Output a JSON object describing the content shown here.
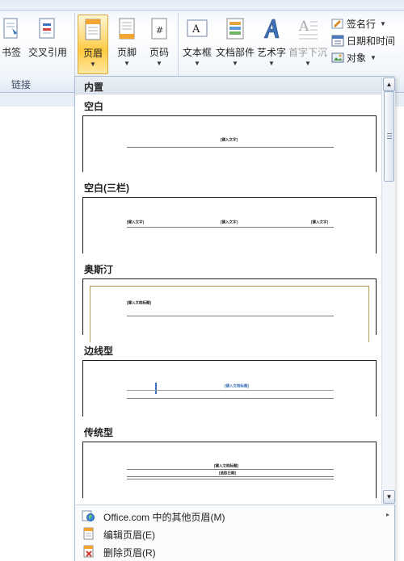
{
  "ribbon": {
    "buttons": [
      {
        "label": "书签",
        "icon": "bookmark-icon"
      },
      {
        "label": "交叉引用",
        "icon": "cross-reference-icon"
      },
      {
        "label": "页眉",
        "icon": "header-icon"
      },
      {
        "label": "页脚",
        "icon": "footer-icon"
      },
      {
        "label": "页码",
        "icon": "page-number-icon"
      },
      {
        "label": "文本框",
        "icon": "textbox-icon"
      },
      {
        "label": "文档部件",
        "icon": "quick-parts-icon"
      },
      {
        "label": "艺术字",
        "icon": "wordart-icon"
      },
      {
        "label": "首字下沉",
        "icon": "drop-cap-icon"
      }
    ],
    "small_buttons": [
      {
        "label": "签名行",
        "icon": "signature-line-icon"
      },
      {
        "label": "日期和时间",
        "icon": "date-time-icon"
      },
      {
        "label": "对象",
        "icon": "object-icon"
      }
    ],
    "group_label": "链接",
    "accent": "#ffc93f"
  },
  "gallery": {
    "header": "内置",
    "sections": [
      {
        "title": "空白",
        "placeholders": [
          "[键入文字]"
        ]
      },
      {
        "title": "空白(三栏)",
        "placeholders": [
          "[键入文字]",
          "[键入文字]",
          "[键入文字]"
        ]
      },
      {
        "title": "奥斯汀",
        "placeholders": [
          "[键入文档标题]"
        ]
      },
      {
        "title": "边线型",
        "placeholders": [
          "[键入文档标题]"
        ]
      },
      {
        "title": "传统型",
        "placeholders": [
          "[键入文档标题]",
          "[选取日期]"
        ]
      }
    ],
    "scroll_up": "▲",
    "scroll_down": "▼"
  },
  "menu": {
    "items": [
      {
        "label": "Office.com 中的其他页眉(M)",
        "icon": "office-online-icon",
        "submenu": "▸"
      },
      {
        "label": "编辑页眉(E)",
        "icon": "edit-header-icon"
      },
      {
        "label": "删除页眉(R)",
        "icon": "remove-header-icon"
      }
    ]
  }
}
